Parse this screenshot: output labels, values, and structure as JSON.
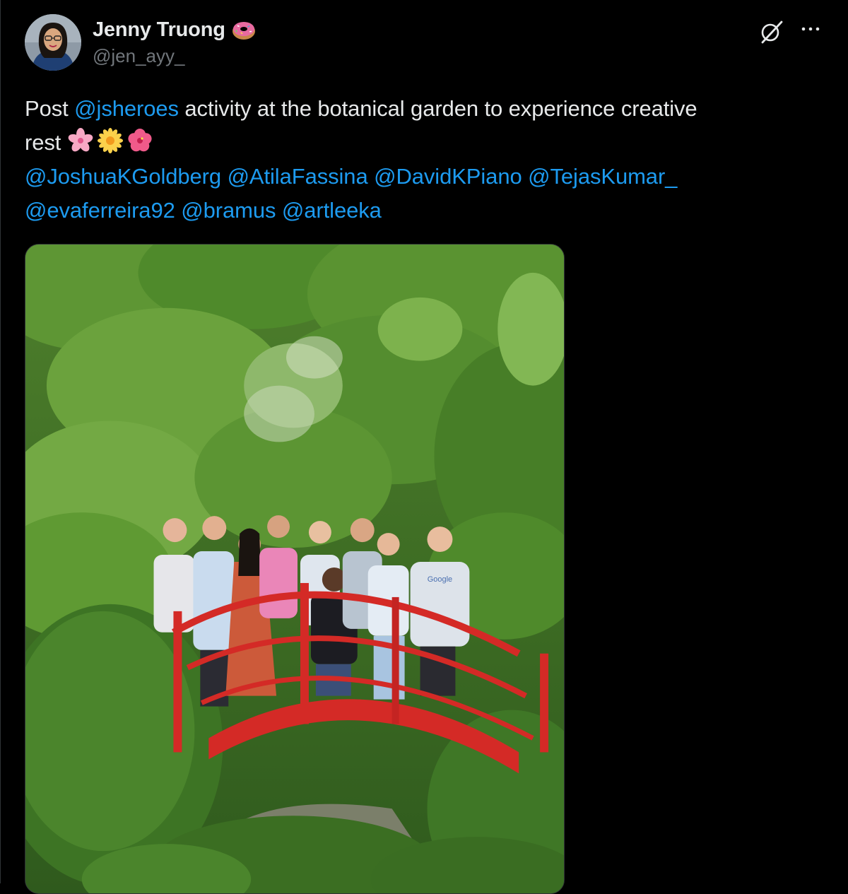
{
  "author": {
    "display_name": "Jenny Truong",
    "name_emoji": "donut-emoji",
    "handle": "@jen_ayy_"
  },
  "tweet": {
    "line1_prefix": "Post ",
    "line1_mention": "@jsheroes",
    "line1_suffix": " activity at the botanical garden to experience creative",
    "line2_text": "rest",
    "line2_emojis": [
      "cherry-blossom-emoji",
      "blossom-emoji",
      "hibiscus-emoji"
    ],
    "mentions_line3": [
      "@JoshuaKGoldberg",
      "@AtilaFassina",
      "@DavidKPiano",
      "@TejasKumar_"
    ],
    "mentions_line4": [
      "@evaferreira92",
      "@bramus",
      "@artleeka"
    ]
  },
  "media": {
    "type": "photo",
    "subject": "group of people on a red arched bridge in a green botanical garden",
    "shirt_text": "Google"
  },
  "icons": {
    "grok": "grok-icon",
    "more": "more-dots-icon"
  },
  "colors": {
    "background": "#000000",
    "text": "#e7e9ea",
    "secondary_text": "#71767b",
    "link": "#1d9bf0",
    "bridge_red": "#d42a26"
  }
}
